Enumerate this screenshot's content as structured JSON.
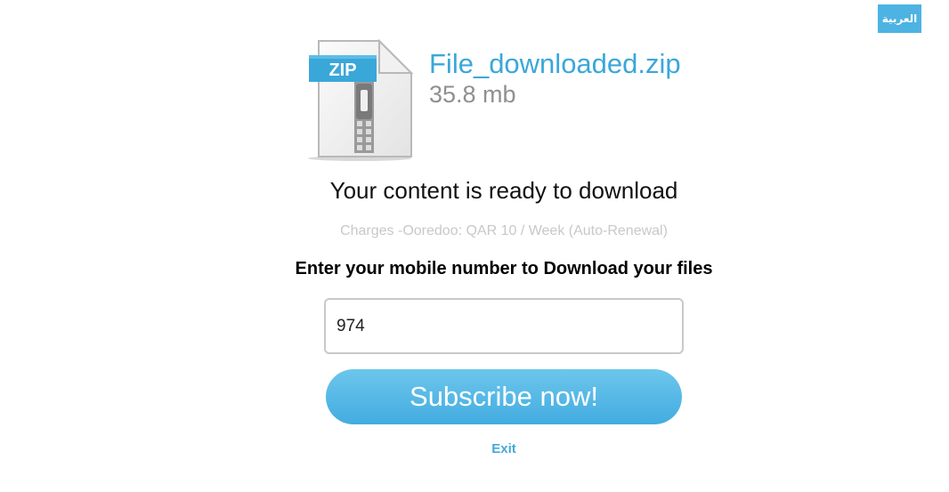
{
  "language_button": {
    "label": "العربية"
  },
  "file": {
    "icon": "zip-file-icon",
    "icon_label": "ZIP",
    "name": "File_downloaded.zip",
    "size": "35.8 mb"
  },
  "main": {
    "ready_text": "Your content is ready to download",
    "charges_text": "Charges -Ooredoo: QAR 10 / Week (Auto-Renewal)",
    "prompt_text": "Enter your mobile number to Download your files"
  },
  "form": {
    "mobile_value": "974",
    "subscribe_label": "Subscribe now!",
    "exit_label": "Exit"
  },
  "colors": {
    "accent": "#4db3e2",
    "file_name": "#3aa7d9",
    "muted": "#c8c8c8"
  }
}
